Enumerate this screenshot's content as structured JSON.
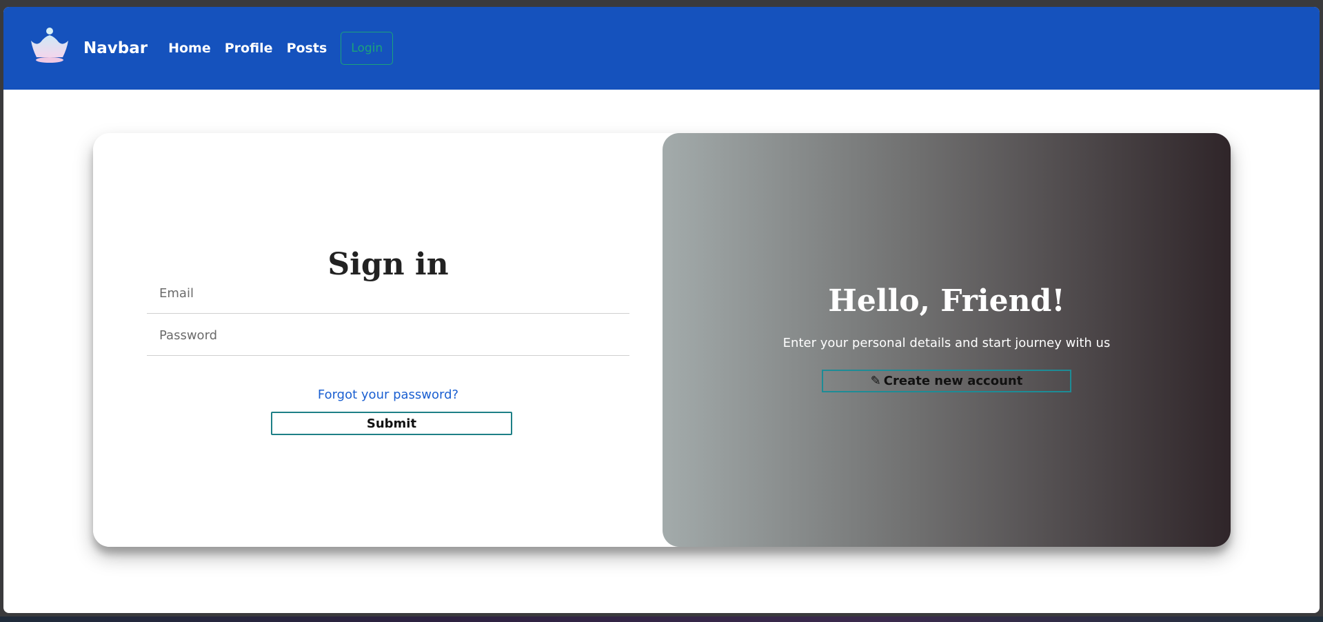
{
  "navbar": {
    "brand": "Navbar",
    "links": [
      "Home",
      "Profile",
      "Posts"
    ],
    "login_label": "Login",
    "logo_icon": "crown-icon"
  },
  "signin": {
    "title": "Sign in",
    "email_placeholder": "Email",
    "password_placeholder": "Password",
    "forgot_label": "Forgot your password?",
    "submit_label": "Submit"
  },
  "welcome": {
    "title": "Hello, Friend!",
    "subtitle": "Enter your personal details and start journey with us",
    "create_label": "Create new account",
    "create_icon": "pencil-icon"
  },
  "colors": {
    "navbar_bg": "#1552bd",
    "login_accent": "#1ba37a",
    "link_blue": "#1a5fd1",
    "button_border": "#1d7f86"
  }
}
